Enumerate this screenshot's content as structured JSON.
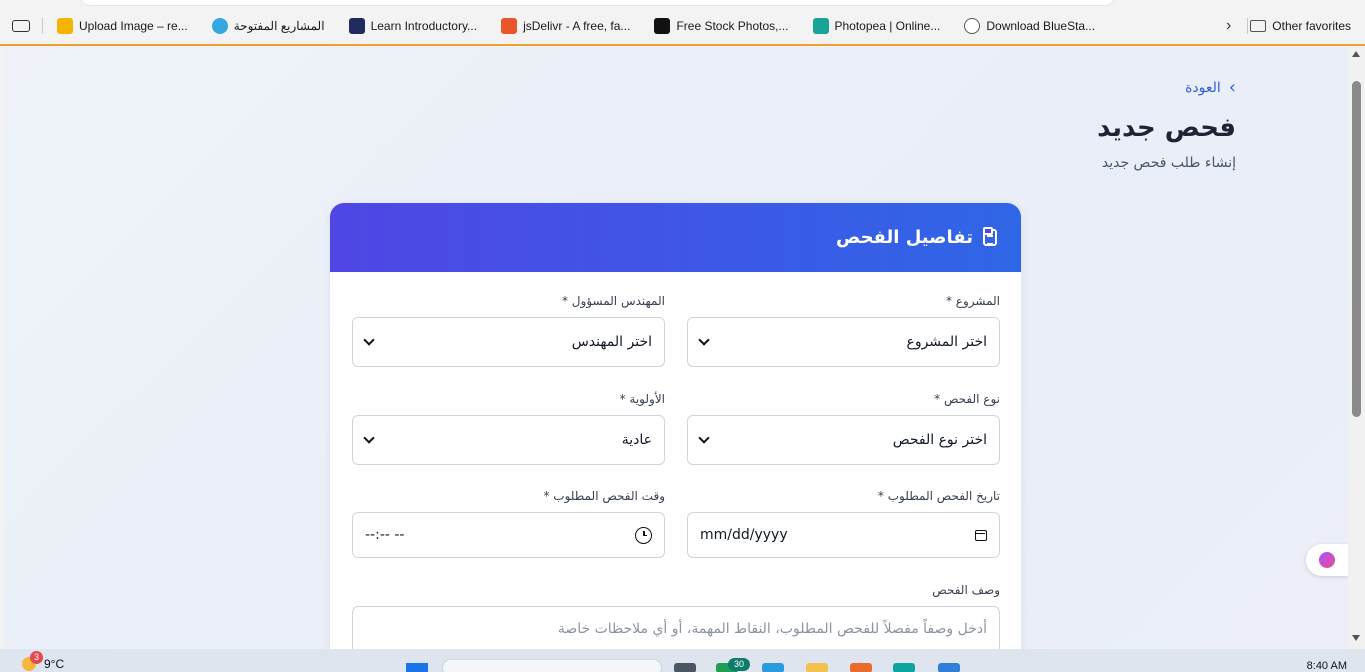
{
  "bookmarks": {
    "items": [
      {
        "label": "Upload Image – re...",
        "color": "#f5b400"
      },
      {
        "label": "المشاريع المفتوحة",
        "color": "#36a7e0"
      },
      {
        "label": "Learn Introductory...",
        "color": "#1f2b5c"
      },
      {
        "label": "jsDelivr - A free, fa...",
        "color": "#e8562a"
      },
      {
        "label": "Free Stock Photos,...",
        "color": "#111111"
      },
      {
        "label": "Photopea | Online...",
        "color": "#18a497"
      },
      {
        "label": "Download BlueSta...",
        "color": "#555555"
      }
    ],
    "more_icon": "chevron-right-icon",
    "other_favorites": "Other favorites"
  },
  "page": {
    "back_label": "العودة",
    "title": "فحص جديد",
    "subtitle": "إنشاء طلب فحص جديد",
    "card_title": "تفاصيل الفحص",
    "accent_start": "#4f46e5",
    "accent_end": "#2f66e6",
    "link_color": "#2f5fd8"
  },
  "form": {
    "project": {
      "label": "المشروع *",
      "value": "اختر المشروع"
    },
    "engineer": {
      "label": "المهندس المسؤول *",
      "value": "اختر المهندس"
    },
    "inspection_type": {
      "label": "نوع الفحص *",
      "value": "اختر نوع الفحص"
    },
    "priority": {
      "label": "الأولوية *",
      "value": "عادية"
    },
    "date": {
      "label": "تاريخ الفحص المطلوب *",
      "value": "mm/dd/yyyy"
    },
    "time": {
      "label": "وقت الفحص المطلوب *",
      "value": "--:-- --"
    },
    "description": {
      "label": "وصف الفحص",
      "placeholder": "أدخل وصفاً مفصلاً للفحص المطلوب، النقاط المهمة، أو أي ملاحظات خاصة"
    }
  },
  "taskbar": {
    "weather_badge": "3",
    "temperature": "9°C",
    "app_badge": "30",
    "time": "8:40 AM"
  }
}
